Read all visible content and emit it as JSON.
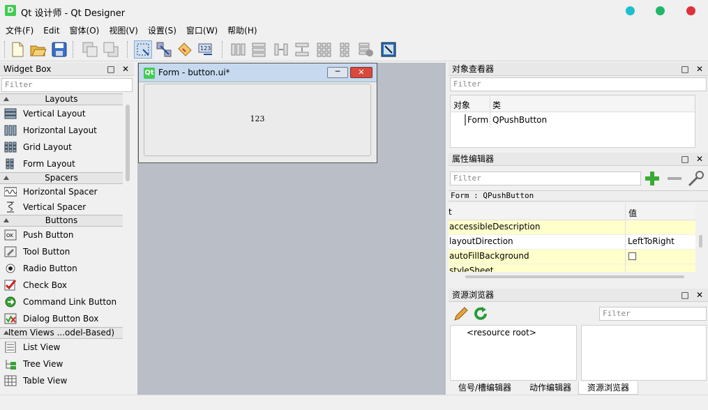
{
  "window": {
    "title": "Qt 设计师 - Qt Designer",
    "app_icon": "D"
  },
  "controls": {
    "colors": [
      "#1fbfcf",
      "#1fb86a",
      "#e0303a"
    ]
  },
  "menu": [
    "文件(F)",
    "Edit",
    "窗体(O)",
    "视图(V)",
    "设置(S)",
    "窗口(W)",
    "帮助(H)"
  ],
  "toolbar": {
    "buttons": [
      "new-file-icon",
      "open-folder-icon",
      "save-icon",
      "bring-forward-icon",
      "send-back-icon",
      "edit-widgets-icon",
      "edit-signals-icon",
      "edit-buddies-icon",
      "edit-tab-order-icon",
      "layout-horizontal-icon",
      "layout-vertical-icon",
      "layout-split-horizontal-icon",
      "layout-split-vertical-icon",
      "layout-grid-icon",
      "layout-form-icon",
      "break-layout-icon",
      "adjust-size-icon"
    ]
  },
  "widget_box": {
    "title": "Widget Box",
    "filter_placeholder": "Filter",
    "categories": [
      {
        "label": "Layouts",
        "items": [
          "Vertical Layout",
          "Horizontal Layout",
          "Grid Layout",
          "Form Layout"
        ]
      },
      {
        "label": "Spacers",
        "items": [
          "Horizontal Spacer",
          "Vertical Spacer"
        ]
      },
      {
        "label": "Buttons",
        "items": [
          "Push Button",
          "Tool Button",
          "Radio Button",
          "Check Box",
          "Command Link Button",
          "Dialog Button Box"
        ]
      },
      {
        "label": "Item Views ...odel-Based)",
        "items": [
          "List View",
          "Tree View",
          "Table View"
        ]
      }
    ]
  },
  "form": {
    "title": "Form - button.ui*",
    "button_text": "123",
    "icon": "Qt"
  },
  "object_inspector": {
    "title": "对象查看器",
    "filter_placeholder": "Filter",
    "headers": [
      "对象",
      "类"
    ],
    "rows": [
      {
        "object": "Form",
        "class": "QPushButton"
      }
    ]
  },
  "property_editor": {
    "title": "属性编辑器",
    "filter_placeholder": "Filter",
    "context": "Form : QPushButton",
    "headers": [
      "t",
      "值"
    ],
    "rows": [
      {
        "name": "accessibleDescription",
        "value": ""
      },
      {
        "name": "layoutDirection",
        "value": "LeftToRight"
      },
      {
        "name": "autoFillBackground",
        "value": ""
      },
      {
        "name": "styleSheet",
        "value": ""
      }
    ]
  },
  "resource_browser": {
    "title": "资源浏览器",
    "filter_placeholder": "Filter",
    "root": "<resource root>"
  },
  "bottom_tabs": [
    "信号/槽编辑器",
    "动作编辑器",
    "资源浏览器"
  ]
}
